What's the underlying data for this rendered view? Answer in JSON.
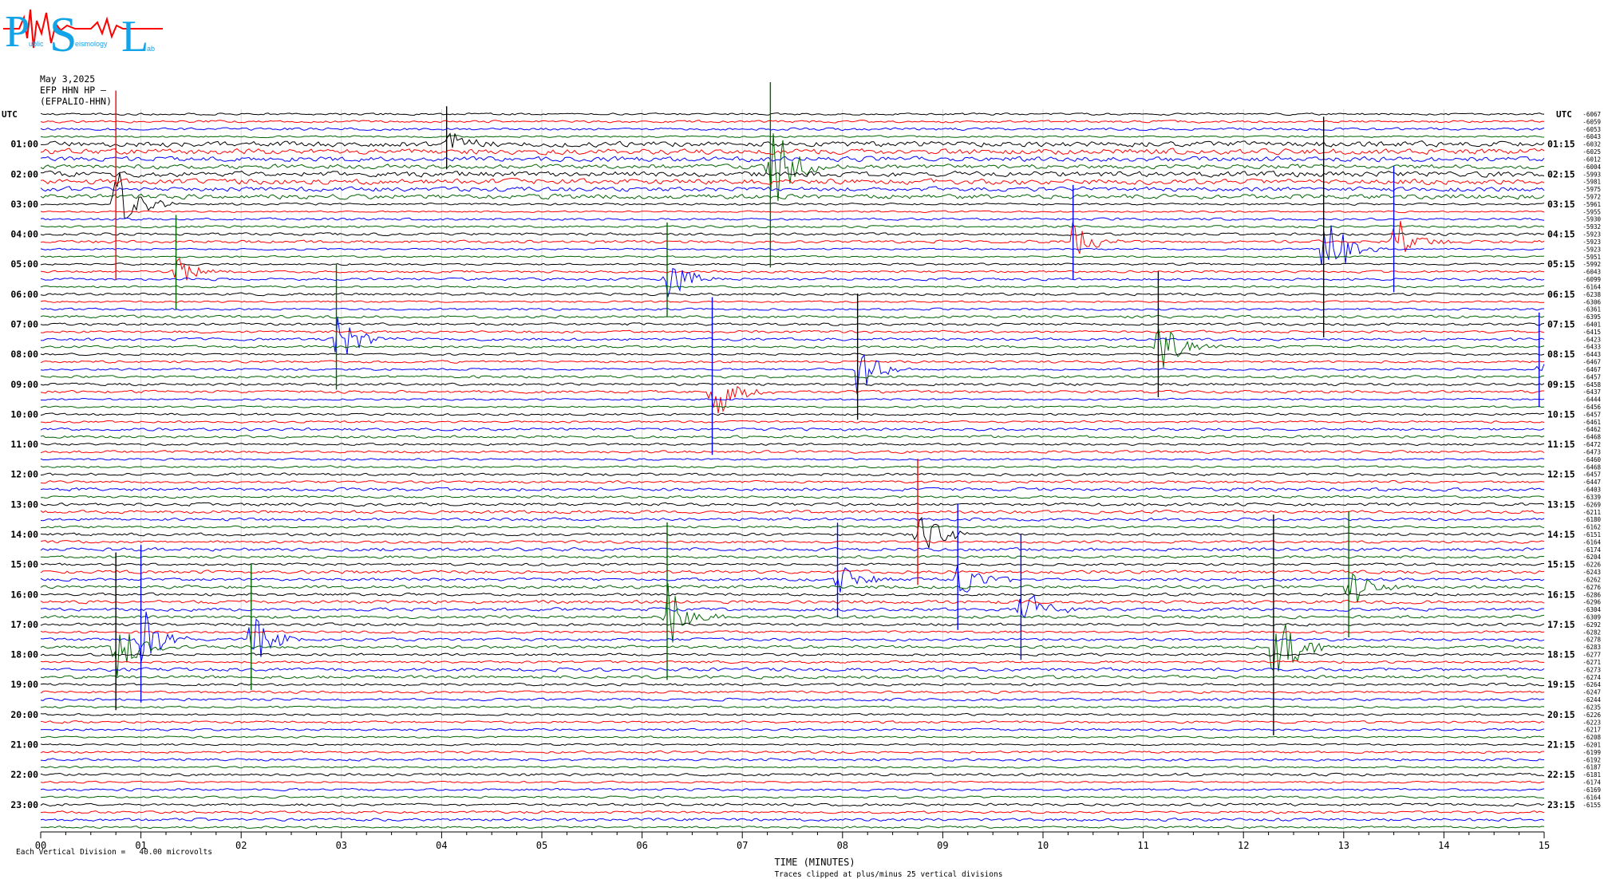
{
  "logo": {
    "letters": [
      "P",
      "S",
      "L"
    ],
    "small_words": [
      "ublic",
      "eismology",
      "ab"
    ],
    "colors": {
      "letters": "#13a4e8",
      "squiggle": "#ff0000"
    }
  },
  "header": {
    "date": "May 3,2025",
    "station": "EFP HHN HP —",
    "channel_id": "(EFPALIO-HHN)"
  },
  "chart_data": {
    "type": "line",
    "title": "",
    "utc_label_left": "UTC",
    "utc_label_right": "UTC",
    "left_hour_labels": [
      "01:00",
      "02:00",
      "03:00",
      "04:00",
      "05:00",
      "06:00",
      "07:00",
      "08:00",
      "09:00",
      "10:00",
      "11:00",
      "12:00",
      "13:00",
      "14:00",
      "15:00",
      "16:00",
      "17:00",
      "18:00",
      "19:00",
      "20:00",
      "21:00",
      "22:00",
      "23:00"
    ],
    "right_hour_labels": [
      "01:15",
      "02:15",
      "03:15",
      "04:15",
      "05:15",
      "06:15",
      "07:15",
      "08:15",
      "09:15",
      "10:15",
      "11:15",
      "12:15",
      "13:15",
      "14:15",
      "15:15",
      "16:15",
      "17:15",
      "18:15",
      "19:15",
      "20:15",
      "21:15",
      "22:15",
      "23:15"
    ],
    "x_ticks": [
      "00",
      "01",
      "02",
      "03",
      "04",
      "05",
      "06",
      "07",
      "08",
      "09",
      "10",
      "11",
      "12",
      "13",
      "14",
      "15"
    ],
    "xlim": [
      0,
      15
    ],
    "xlabel": "TIME (MINUTES)",
    "clip_note": "Traces clipped at plus/minus 25 vertical divisions",
    "vertical_division_note": "Each Vertical Division =   40.00 microvolts",
    "trace_minutes": 15,
    "trace_count": 96,
    "trace_color_cycle": [
      "#000000",
      "#ff0000",
      "#0000ff",
      "#006400"
    ],
    "right_trace_values": [
      "-6067",
      "-6059",
      "-6053",
      "-6043",
      "-6032",
      "-6025",
      "-6012",
      "-6004",
      "-5993",
      "-5981",
      "-5975",
      "-5972",
      "-5961",
      "-5955",
      "-5930",
      "-5932",
      "-5923",
      "-5923",
      "-5923",
      "-5951",
      "-5992",
      "-6043",
      "-6099",
      "-6164",
      "-6238",
      "-6306",
      "-6361",
      "-6395",
      "-6401",
      "-6415",
      "-6423",
      "-6433",
      "-6443",
      "-6467",
      "-6467",
      "-6457",
      "-6458",
      "-6437",
      "-6444",
      "-6456",
      "-6457",
      "-6461",
      "-6462",
      "-6468",
      "-6472",
      "-6473",
      "-6460",
      "-6468",
      "-6457",
      "-6447",
      "-6403",
      "-6339",
      "-6269",
      "-6211",
      "-6180",
      "-6162",
      "-6151",
      "-6164",
      "-6174",
      "-6204",
      "-6226",
      "-6243",
      "-6262",
      "-6276",
      "-6286",
      "-6296",
      "-6304",
      "-6309",
      "-6292",
      "-6282",
      "-6278",
      "-6283",
      "-6277",
      "-6271",
      "-6273",
      "-6274",
      "-6264",
      "-6247",
      "-6244",
      "-6235",
      "-6226",
      "-6223",
      "-6217",
      "-6208",
      "-6201",
      "-6199",
      "-6192",
      "-6187",
      "-6181",
      "-6174",
      "-6169",
      "-6164",
      "-6155"
    ],
    "events": [
      {
        "minute": 0.75,
        "trace": 12,
        "color": "#ff0000",
        "amplitude": 6
      },
      {
        "minute": 4.05,
        "trace": 4,
        "color": "#000000",
        "amplitude": 2
      },
      {
        "minute": 7.28,
        "trace": 7,
        "color": "#006400",
        "amplitude": 8
      },
      {
        "minute": 12.8,
        "trace": 18,
        "color": "#000000",
        "amplitude": 7
      },
      {
        "minute": 13.5,
        "trace": 17,
        "color": "#0000ff",
        "amplitude": 4
      },
      {
        "minute": 11.15,
        "trace": 31,
        "color": "#000000",
        "amplitude": 4
      },
      {
        "minute": 6.7,
        "trace": 37,
        "color": "#0000ff",
        "amplitude": 5
      },
      {
        "minute": 8.15,
        "trace": 34,
        "color": "#000000",
        "amplitude": 4
      },
      {
        "minute": 2.95,
        "trace": 30,
        "color": "#006400",
        "amplitude": 4
      },
      {
        "minute": 1.35,
        "trace": 21,
        "color": "#006400",
        "amplitude": 3
      },
      {
        "minute": 6.25,
        "trace": 22,
        "color": "#006400",
        "amplitude": 3
      },
      {
        "minute": 10.3,
        "trace": 17,
        "color": "#0000ff",
        "amplitude": 3
      },
      {
        "minute": 14.95,
        "trace": 34,
        "color": "#0000ff",
        "amplitude": 3
      },
      {
        "minute": 8.75,
        "trace": 56,
        "color": "#ff0000",
        "amplitude": 4
      },
      {
        "minute": 9.15,
        "trace": 62,
        "color": "#0000ff",
        "amplitude": 4
      },
      {
        "minute": 9.78,
        "trace": 66,
        "color": "#0000ff",
        "amplitude": 4
      },
      {
        "minute": 7.95,
        "trace": 62,
        "color": "#0000ff",
        "amplitude": 3
      },
      {
        "minute": 12.3,
        "trace": 71,
        "color": "#000000",
        "amplitude": 7
      },
      {
        "minute": 13.05,
        "trace": 63,
        "color": "#006400",
        "amplitude": 4
      },
      {
        "minute": 0.75,
        "trace": 71,
        "color": "#000000",
        "amplitude": 5
      },
      {
        "minute": 1.0,
        "trace": 70,
        "color": "#0000ff",
        "amplitude": 5
      },
      {
        "minute": 2.1,
        "trace": 70,
        "color": "#006400",
        "amplitude": 4
      },
      {
        "minute": 6.25,
        "trace": 67,
        "color": "#006400",
        "amplitude": 5
      }
    ]
  }
}
